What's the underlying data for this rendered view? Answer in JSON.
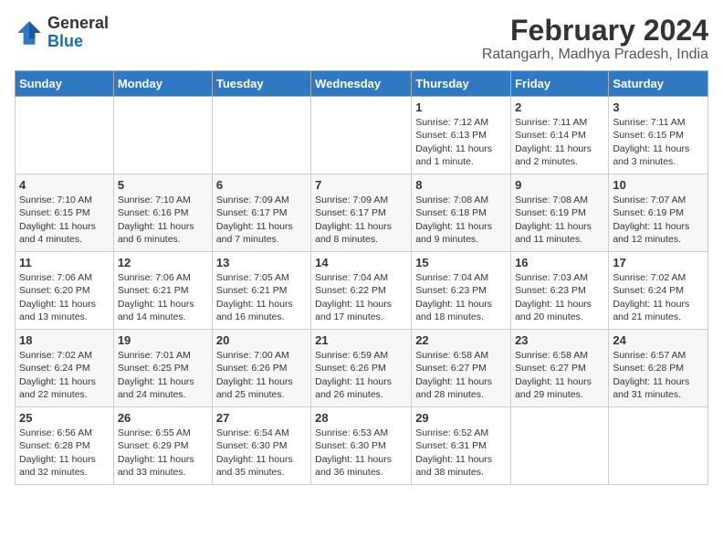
{
  "header": {
    "logo_general": "General",
    "logo_blue": "Blue",
    "title": "February 2024",
    "subtitle": "Ratangarh, Madhya Pradesh, India"
  },
  "days_of_week": [
    "Sunday",
    "Monday",
    "Tuesday",
    "Wednesday",
    "Thursday",
    "Friday",
    "Saturday"
  ],
  "weeks": [
    [
      {
        "day": "",
        "info": ""
      },
      {
        "day": "",
        "info": ""
      },
      {
        "day": "",
        "info": ""
      },
      {
        "day": "",
        "info": ""
      },
      {
        "day": "1",
        "info": "Sunrise: 7:12 AM\nSunset: 6:13 PM\nDaylight: 11 hours and 1 minute."
      },
      {
        "day": "2",
        "info": "Sunrise: 7:11 AM\nSunset: 6:14 PM\nDaylight: 11 hours and 2 minutes."
      },
      {
        "day": "3",
        "info": "Sunrise: 7:11 AM\nSunset: 6:15 PM\nDaylight: 11 hours and 3 minutes."
      }
    ],
    [
      {
        "day": "4",
        "info": "Sunrise: 7:10 AM\nSunset: 6:15 PM\nDaylight: 11 hours and 4 minutes."
      },
      {
        "day": "5",
        "info": "Sunrise: 7:10 AM\nSunset: 6:16 PM\nDaylight: 11 hours and 6 minutes."
      },
      {
        "day": "6",
        "info": "Sunrise: 7:09 AM\nSunset: 6:17 PM\nDaylight: 11 hours and 7 minutes."
      },
      {
        "day": "7",
        "info": "Sunrise: 7:09 AM\nSunset: 6:17 PM\nDaylight: 11 hours and 8 minutes."
      },
      {
        "day": "8",
        "info": "Sunrise: 7:08 AM\nSunset: 6:18 PM\nDaylight: 11 hours and 9 minutes."
      },
      {
        "day": "9",
        "info": "Sunrise: 7:08 AM\nSunset: 6:19 PM\nDaylight: 11 hours and 11 minutes."
      },
      {
        "day": "10",
        "info": "Sunrise: 7:07 AM\nSunset: 6:19 PM\nDaylight: 11 hours and 12 minutes."
      }
    ],
    [
      {
        "day": "11",
        "info": "Sunrise: 7:06 AM\nSunset: 6:20 PM\nDaylight: 11 hours and 13 minutes."
      },
      {
        "day": "12",
        "info": "Sunrise: 7:06 AM\nSunset: 6:21 PM\nDaylight: 11 hours and 14 minutes."
      },
      {
        "day": "13",
        "info": "Sunrise: 7:05 AM\nSunset: 6:21 PM\nDaylight: 11 hours and 16 minutes."
      },
      {
        "day": "14",
        "info": "Sunrise: 7:04 AM\nSunset: 6:22 PM\nDaylight: 11 hours and 17 minutes."
      },
      {
        "day": "15",
        "info": "Sunrise: 7:04 AM\nSunset: 6:23 PM\nDaylight: 11 hours and 18 minutes."
      },
      {
        "day": "16",
        "info": "Sunrise: 7:03 AM\nSunset: 6:23 PM\nDaylight: 11 hours and 20 minutes."
      },
      {
        "day": "17",
        "info": "Sunrise: 7:02 AM\nSunset: 6:24 PM\nDaylight: 11 hours and 21 minutes."
      }
    ],
    [
      {
        "day": "18",
        "info": "Sunrise: 7:02 AM\nSunset: 6:24 PM\nDaylight: 11 hours and 22 minutes."
      },
      {
        "day": "19",
        "info": "Sunrise: 7:01 AM\nSunset: 6:25 PM\nDaylight: 11 hours and 24 minutes."
      },
      {
        "day": "20",
        "info": "Sunrise: 7:00 AM\nSunset: 6:26 PM\nDaylight: 11 hours and 25 minutes."
      },
      {
        "day": "21",
        "info": "Sunrise: 6:59 AM\nSunset: 6:26 PM\nDaylight: 11 hours and 26 minutes."
      },
      {
        "day": "22",
        "info": "Sunrise: 6:58 AM\nSunset: 6:27 PM\nDaylight: 11 hours and 28 minutes."
      },
      {
        "day": "23",
        "info": "Sunrise: 6:58 AM\nSunset: 6:27 PM\nDaylight: 11 hours and 29 minutes."
      },
      {
        "day": "24",
        "info": "Sunrise: 6:57 AM\nSunset: 6:28 PM\nDaylight: 11 hours and 31 minutes."
      }
    ],
    [
      {
        "day": "25",
        "info": "Sunrise: 6:56 AM\nSunset: 6:28 PM\nDaylight: 11 hours and 32 minutes."
      },
      {
        "day": "26",
        "info": "Sunrise: 6:55 AM\nSunset: 6:29 PM\nDaylight: 11 hours and 33 minutes."
      },
      {
        "day": "27",
        "info": "Sunrise: 6:54 AM\nSunset: 6:30 PM\nDaylight: 11 hours and 35 minutes."
      },
      {
        "day": "28",
        "info": "Sunrise: 6:53 AM\nSunset: 6:30 PM\nDaylight: 11 hours and 36 minutes."
      },
      {
        "day": "29",
        "info": "Sunrise: 6:52 AM\nSunset: 6:31 PM\nDaylight: 11 hours and 38 minutes."
      },
      {
        "day": "",
        "info": ""
      },
      {
        "day": "",
        "info": ""
      }
    ]
  ]
}
